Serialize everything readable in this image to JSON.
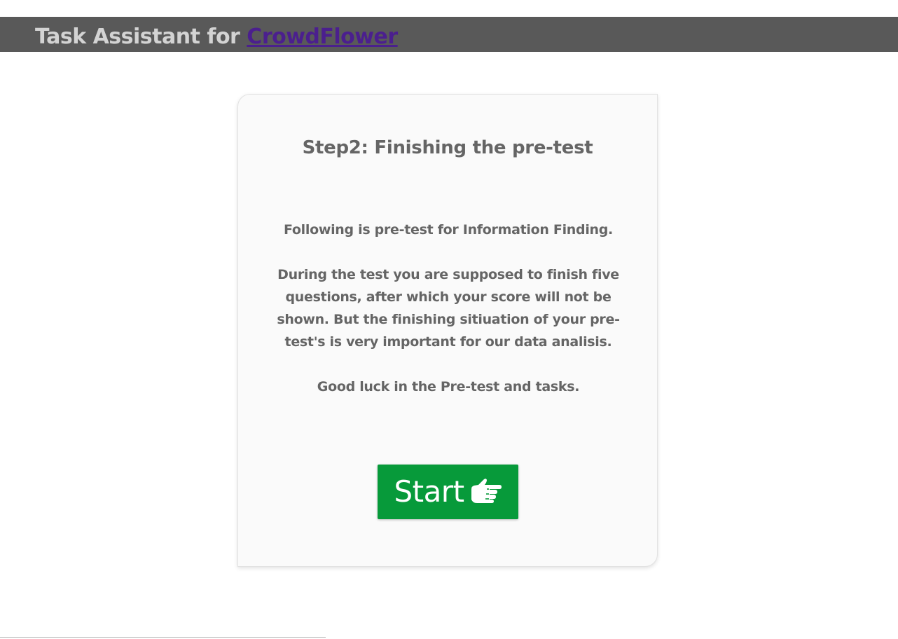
{
  "header": {
    "title_prefix": "Task Assistant for ",
    "title_link": "CrowdFlower"
  },
  "card": {
    "heading": "Step2: Finishing the pre-test",
    "intro": "Following is pre-test for Information Finding.",
    "instructions": "During the test you are supposed to finish five questions, after which your score will not be shown. But the finishing sitiuation of your pre-test's is very important for our data analisis.",
    "closing": "Good luck in the Pre-test and tasks.",
    "start_button": {
      "label": "Start",
      "icon": "pointing-hand-icon",
      "color": "#079a3a"
    }
  },
  "colors": {
    "header_bg": "#595959",
    "header_text": "#d3d3d3",
    "link": "#4b1f8e",
    "body_text": "#656565",
    "card_bg": "#fafafa"
  }
}
